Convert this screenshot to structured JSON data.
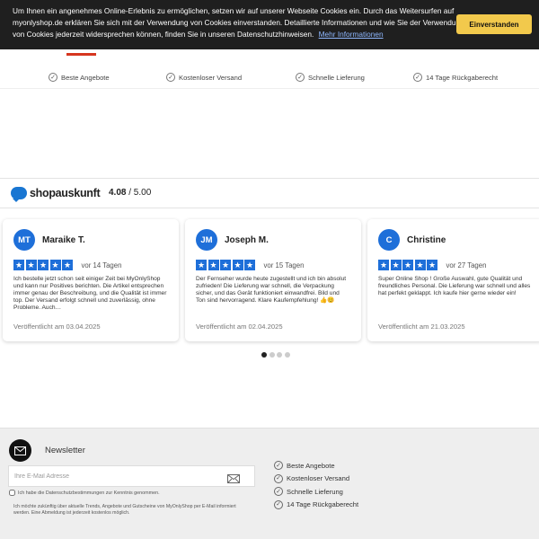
{
  "cookie": {
    "text": "Um Ihnen ein angenehmes Online-Erlebnis zu ermöglichen, setzen wir auf unserer Webseite Cookies ein. Durch das Weitersurfen auf myonlyshop.de erklären Sie sich mit der Verwendung von Cookies einverstanden. Detaillierte Informationen und wie Sie der Verwendung von Cookies jederzeit widersprechen können, finden Sie in unseren Datenschutzhinweisen.",
    "link": "Mehr Informationen",
    "button": "Einverstanden"
  },
  "usps": [
    {
      "label": "Beste Angebote"
    },
    {
      "label": "Kostenloser Versand"
    },
    {
      "label": "Schnelle Lieferung"
    },
    {
      "label": "14 Tage Rückgaberecht"
    }
  ],
  "rating": {
    "brand": "shopauskunft",
    "score": "4.08",
    "max": "/ 5.00"
  },
  "reviews": [
    {
      "initials": "MT",
      "name": "Maraike T.",
      "ago": "vor 14 Tagen",
      "stars": 5,
      "text": "Ich bestelle jetzt schon seit einiger Zeit bei MyOnlyShop und kann nur Positives berichten. Die Artikel entsprechen immer genau der Beschreibung, und die Qualität ist immer top. Der Versand erfolgt schnell und zuverlässig, ohne Probleme. Auch…",
      "date": "Veröffentlicht am 03.04.2025"
    },
    {
      "initials": "JM",
      "name": "Joseph M.",
      "ago": "vor 15 Tagen",
      "stars": 5,
      "text": "Der Fernseher wurde heute zugestellt und ich bin absolut zufrieden! Die Lieferung war schnell, die Verpackung sicher, und das Gerät funktioniert einwandfrei. Bild und Ton sind hervorragend. Klare Kaufempfehlung! 👍😊",
      "date": "Veröffentlicht am 02.04.2025"
    },
    {
      "initials": "C",
      "name": "Christine",
      "ago": "vor 27 Tagen",
      "stars": 5,
      "text": "Super Online Shop ! Große Auswahl, gute Qualität und freundliches Personal. Die Lieferung war schnell und alles hat perfekt geklappt. Ich kaufe hier gerne wieder ein!",
      "date": "Veröffentlicht am 21.03.2025"
    }
  ],
  "carousel": {
    "pages": 4,
    "active": 0
  },
  "newsletter": {
    "title": "Newsletter",
    "placeholder": "Ihre E-Mail Adresse",
    "consent": "Ich habe die Datenschutzbestimmungen zur Kenntnis genommen.",
    "info": "Ich möchte zukünftig über aktuelle Trends, Angebote und Gutscheine von MyOnlyShop per E-Mail informiert werden. Eine Abmeldung ist jederzeit kostenlos möglich."
  },
  "colors": {
    "accent": "#1e6fd9",
    "cookie_button": "#f2c94c",
    "cookie_bg": "#1f1f1f"
  }
}
